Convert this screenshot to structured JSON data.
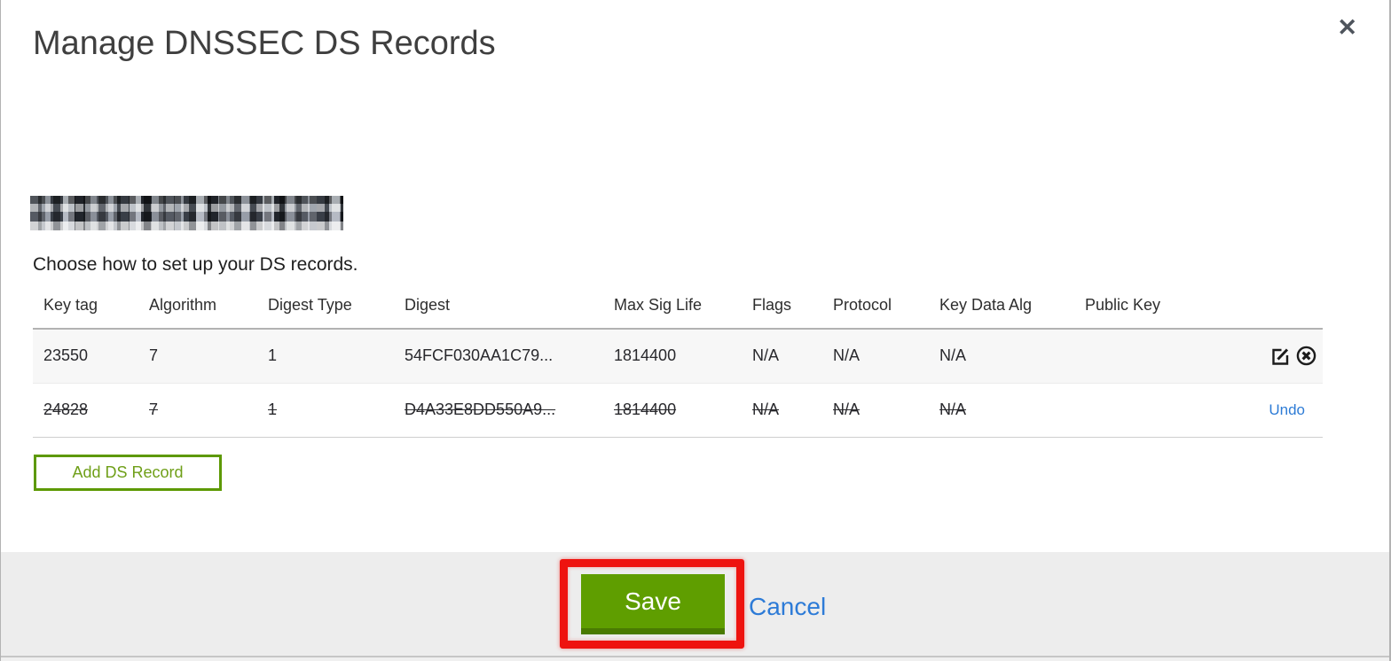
{
  "modal": {
    "title": "Manage DNSSEC DS Records",
    "close_icon": "✕",
    "description": "Choose how to set up your DS records.",
    "table": {
      "columns": [
        "Key tag",
        "Algorithm",
        "Digest Type",
        "Digest",
        "Max Sig Life",
        "Flags",
        "Protocol",
        "Key Data Alg",
        "Public Key"
      ],
      "rows": [
        {
          "key_tag": "23550",
          "algorithm": "7",
          "digest_type": "1",
          "digest": "54FCF030AA1C79...",
          "max_sig_life": "1814400",
          "flags": "N/A",
          "protocol": "N/A",
          "key_data_alg": "N/A",
          "public_key": "",
          "state": "normal"
        },
        {
          "key_tag": "24828",
          "algorithm": "7",
          "digest_type": "1",
          "digest": "D4A33E8DD550A9...",
          "max_sig_life": "1814400",
          "flags": "N/A",
          "protocol": "N/A",
          "key_data_alg": "N/A",
          "public_key": "",
          "state": "deleted",
          "undo_label": "Undo"
        }
      ]
    },
    "add_button_label": "Add DS Record",
    "footer": {
      "save_label": "Save",
      "cancel_label": "Cancel"
    },
    "colors": {
      "button_green": "#5f9e00",
      "button_green_dark": "#4a7b02",
      "outline_green": "#5d9902",
      "link_blue": "#2d7bd7",
      "annotation_red": "#ee130f",
      "row_alt_bg": "#f7f7f7",
      "footer_bg": "#ededed"
    }
  }
}
